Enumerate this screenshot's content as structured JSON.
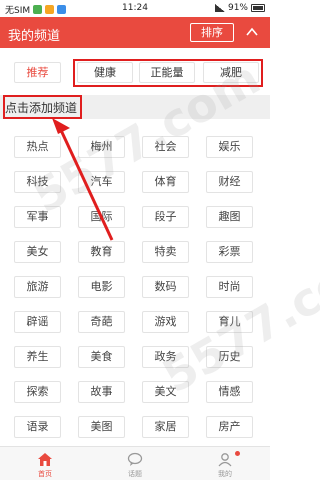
{
  "status_bar": {
    "carrier": "无SIM",
    "time": "11:24",
    "battery": "91%"
  },
  "header": {
    "title": "我的频道",
    "sort_label": "排序"
  },
  "my_channels": [
    {
      "label": "推荐",
      "active": true
    },
    {
      "label": "健康"
    },
    {
      "label": "正能量"
    },
    {
      "label": "减肥"
    }
  ],
  "section": {
    "title": "点击添加频道"
  },
  "channels": [
    "热点",
    "梅州",
    "社会",
    "娱乐",
    "科技",
    "汽车",
    "体育",
    "财经",
    "军事",
    "国际",
    "段子",
    "趣图",
    "美女",
    "教育",
    "特卖",
    "彩票",
    "旅游",
    "电影",
    "数码",
    "时尚",
    "辟谣",
    "奇葩",
    "游戏",
    "育儿",
    "养生",
    "美食",
    "政务",
    "历史",
    "探索",
    "故事",
    "美文",
    "情感",
    "语录",
    "美图",
    "家居",
    "房产"
  ],
  "bottom_nav": [
    {
      "label": "首页",
      "icon": "home-icon",
      "active": true
    },
    {
      "label": "话题",
      "icon": "chat-icon"
    },
    {
      "label": "我的",
      "icon": "person-icon"
    }
  ],
  "watermark": "5577.com",
  "colors": {
    "accent": "#e94a3f",
    "annotation": "#e01e1e"
  }
}
